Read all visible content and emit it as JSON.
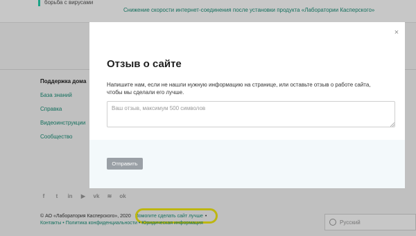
{
  "background": {
    "snippet_text": "борьба с вирусами",
    "article_link": "Снижение скорости интернет-соединения после установки продукта «Лаборатории Касперского»",
    "support": {
      "title": "Поддержка дома",
      "links": [
        "База знаний",
        "Справка",
        "Видеоинструкции",
        "Сообщество"
      ]
    },
    "social_icons": [
      "facebook-icon",
      "twitter-icon",
      "linkedin-icon",
      "youtube-icon",
      "vk-icon",
      "rss-icon",
      "odnoklassniki-icon"
    ],
    "social_glyphs": [
      "f",
      "t",
      "in",
      "▶",
      "vk",
      "≋",
      "ok"
    ],
    "footer": {
      "copyright": "© АО «Лаборатория Касперского», 2020",
      "help_link": "Помогите сделать сайт лучше",
      "bullet": "•",
      "links": [
        "Контакты",
        "Политика конфиденциальности",
        "Юридическая информация"
      ]
    },
    "language": "Русский"
  },
  "modal": {
    "close_glyph": "×",
    "title": "Отзыв о сайте",
    "description": "Напишите нам, если не нашли нужную информацию на странице, или оставьте отзыв о работе сайта, чтобы мы сделали его лучше.",
    "feedback_placeholder": "Ваш отзыв, максимум 500 символов",
    "feedback_value": "",
    "submit_label": "Отправить"
  },
  "colors": {
    "accent": "#23d1ae",
    "link": "#1a8f78",
    "highlight": "#f3ea17",
    "button_disabled": "#9aa0a6"
  }
}
